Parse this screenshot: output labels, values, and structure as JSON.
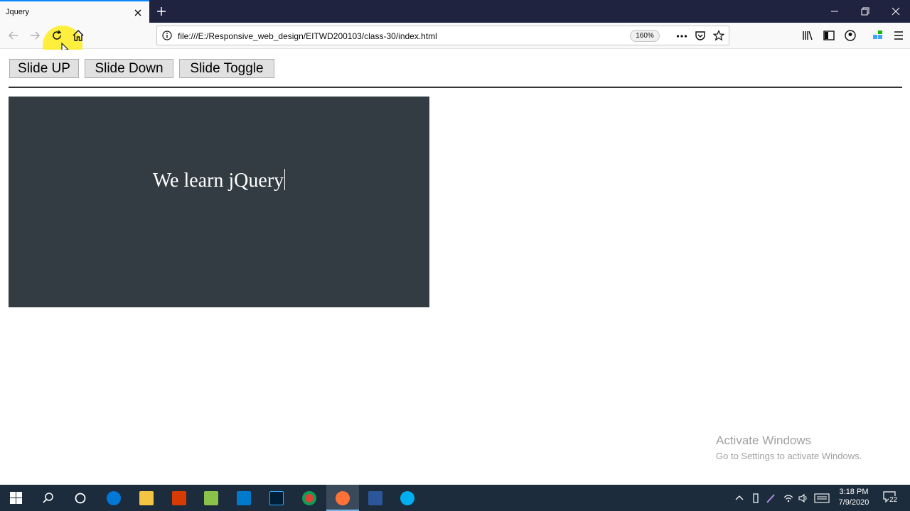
{
  "browser": {
    "tab": {
      "title": "Jquery"
    },
    "address_bar": {
      "url": "file:///E:/Responsive_web_design/EITWD200103/class-30/index.html",
      "zoom": "160%"
    },
    "toolbar_icons": [
      "back-icon",
      "forward-icon",
      "reload-icon",
      "home-icon",
      "info-icon",
      "more-icon",
      "pocket-icon",
      "bookmark-star-icon",
      "library-icon",
      "sidebar-icon",
      "account-icon",
      "extensions-icon",
      "menu-icon"
    ]
  },
  "page": {
    "buttons": {
      "slide_up": "Slide UP",
      "slide_down": "Slide Down",
      "slide_toggle": "Slide Toggle"
    },
    "panel": {
      "text": "We learn jQuery",
      "bg_color": "#323c42"
    }
  },
  "watermark": {
    "title": "Activate Windows",
    "subtitle": "Go to Settings to activate Windows."
  },
  "taskbar": {
    "apps": [
      "start-icon",
      "search-icon",
      "cortana-icon",
      "edge-icon",
      "file-explorer-icon",
      "app-icon",
      "notepad-icon",
      "vscode-icon",
      "photoshop-icon",
      "chrome-icon",
      "firefox-icon",
      "word-icon",
      "skype-icon"
    ],
    "clock": {
      "time": "3:18 PM",
      "date": "7/9/2020"
    },
    "notifications": "22"
  },
  "colors": {
    "accent": "#0a84ff",
    "taskbar": "#1c2c3c",
    "titlebar": "#202340"
  }
}
